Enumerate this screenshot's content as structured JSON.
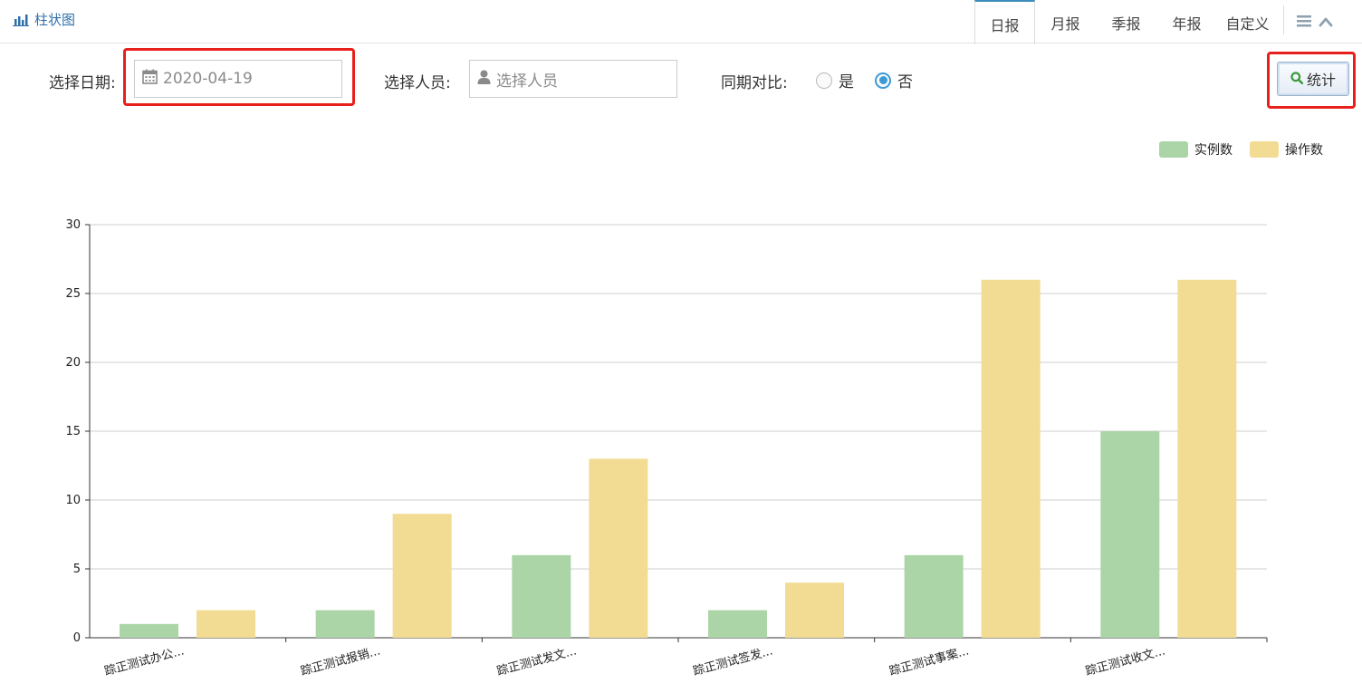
{
  "header": {
    "title": "柱状图",
    "tabs": [
      "日报",
      "月报",
      "季报",
      "年报",
      "自定义"
    ],
    "active_tab": "日报"
  },
  "filters": {
    "date_label": "选择日期:",
    "date_value": "2020-04-19",
    "person_label": "选择人员:",
    "person_placeholder": "选择人员",
    "compare_label": "同期对比:",
    "compare_yes": "是",
    "compare_no": "否",
    "compare_selected": "否",
    "submit_label": "统计"
  },
  "colors": {
    "series_green": "#acd5a7",
    "series_yellow": "#f2dc94",
    "accent_blue": "#3c8dbc",
    "highlight_red": "#e8201b"
  },
  "chart_data": {
    "type": "bar",
    "categories": [
      "踪正测试办公...",
      "踪正测试报销...",
      "踪正测试发文...",
      "踪正测试签发...",
      "踪正测试事案...",
      "踪正测试收文..."
    ],
    "series": [
      {
        "name": "实例数",
        "color": "#acd5a7",
        "values": [
          1,
          2,
          6,
          2,
          6,
          15
        ]
      },
      {
        "name": "操作数",
        "color": "#f2dc94",
        "values": [
          2,
          9,
          13,
          4,
          26,
          26
        ]
      }
    ],
    "ylim": [
      0,
      30
    ],
    "yticks": [
      0,
      5,
      10,
      15,
      20,
      25,
      30
    ],
    "grid": true,
    "legend_position": "top-right",
    "xlabel": "",
    "ylabel": ""
  }
}
